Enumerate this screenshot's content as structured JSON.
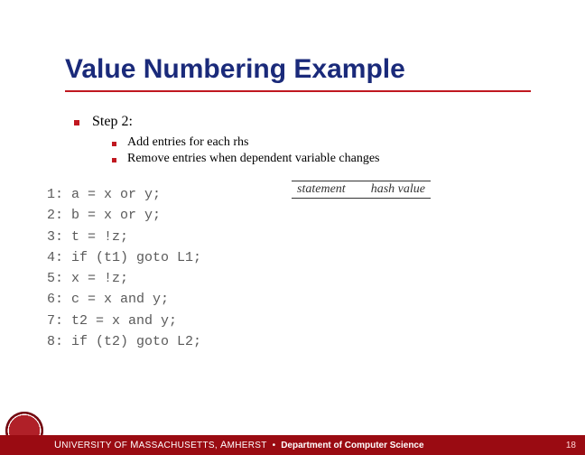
{
  "title": "Value Numbering Example",
  "step_label": "Step 2:",
  "sub_bullets": [
    "Add entries for each rhs",
    "Remove entries when dependent variable changes"
  ],
  "code_lines": [
    "1: a = x or y;",
    "2: b = x or y;",
    "3: t = !z;",
    "4: if (t1) goto L1;",
    "5: x = !z;",
    "6: c = x and y;",
    "7: t2 = x and y;",
    "8: if (t2) goto L2;"
  ],
  "table_headers": {
    "col1": "statement",
    "col2": "hash value"
  },
  "footer": {
    "university_caps": "U",
    "university_rest": "NIVERSITY OF ",
    "mass_caps": "M",
    "mass_rest": "ASSACHUSETTS, ",
    "amh_caps": "A",
    "amh_rest": "MHERST",
    "separator": "•",
    "department": "Department of Computer Science"
  },
  "page_number": "18"
}
